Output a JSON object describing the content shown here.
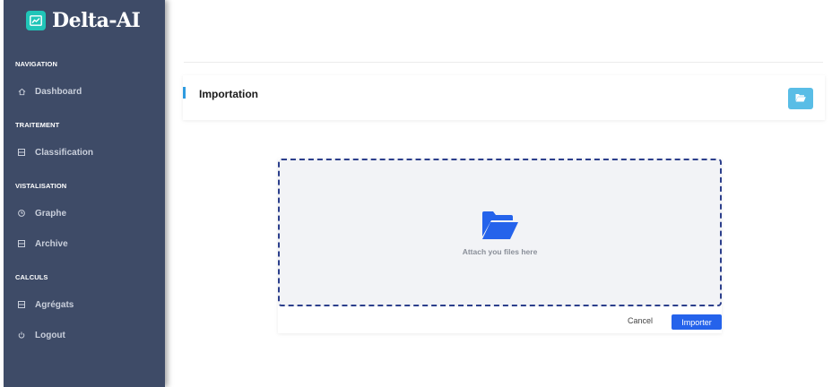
{
  "brand": {
    "name": "Delta-AI",
    "logo_icon": "chart-line-icon",
    "logo_color": "#20c5b8"
  },
  "sidebar": {
    "background": "#3e4b67",
    "sections": [
      {
        "title": "NAVIGATION",
        "items": [
          {
            "label": "Dashboard",
            "icon": "home-icon"
          }
        ]
      },
      {
        "title": "TRAITEMENT",
        "items": [
          {
            "label": "Classification",
            "icon": "list-icon"
          }
        ]
      },
      {
        "title": "VISTALISATION",
        "items": [
          {
            "label": "Graphe",
            "icon": "clock-icon"
          },
          {
            "label": "Archive",
            "icon": "list-icon"
          }
        ]
      },
      {
        "title": "CALCULS",
        "items": [
          {
            "label": "Agrégats",
            "icon": "list-icon"
          },
          {
            "label": "Logout",
            "icon": "power-icon"
          }
        ]
      }
    ]
  },
  "header_card": {
    "title": "Importation",
    "button_icon": "folder-open-icon",
    "accent": "#2f9be0",
    "button_color": "#59bde6"
  },
  "upload": {
    "dropzone_text": "Attach you files here",
    "icon": "folder-open-icon",
    "icon_color": "#2563eb",
    "cancel_label": "Cancel",
    "import_label": "Importer",
    "import_color": "#2563eb"
  }
}
